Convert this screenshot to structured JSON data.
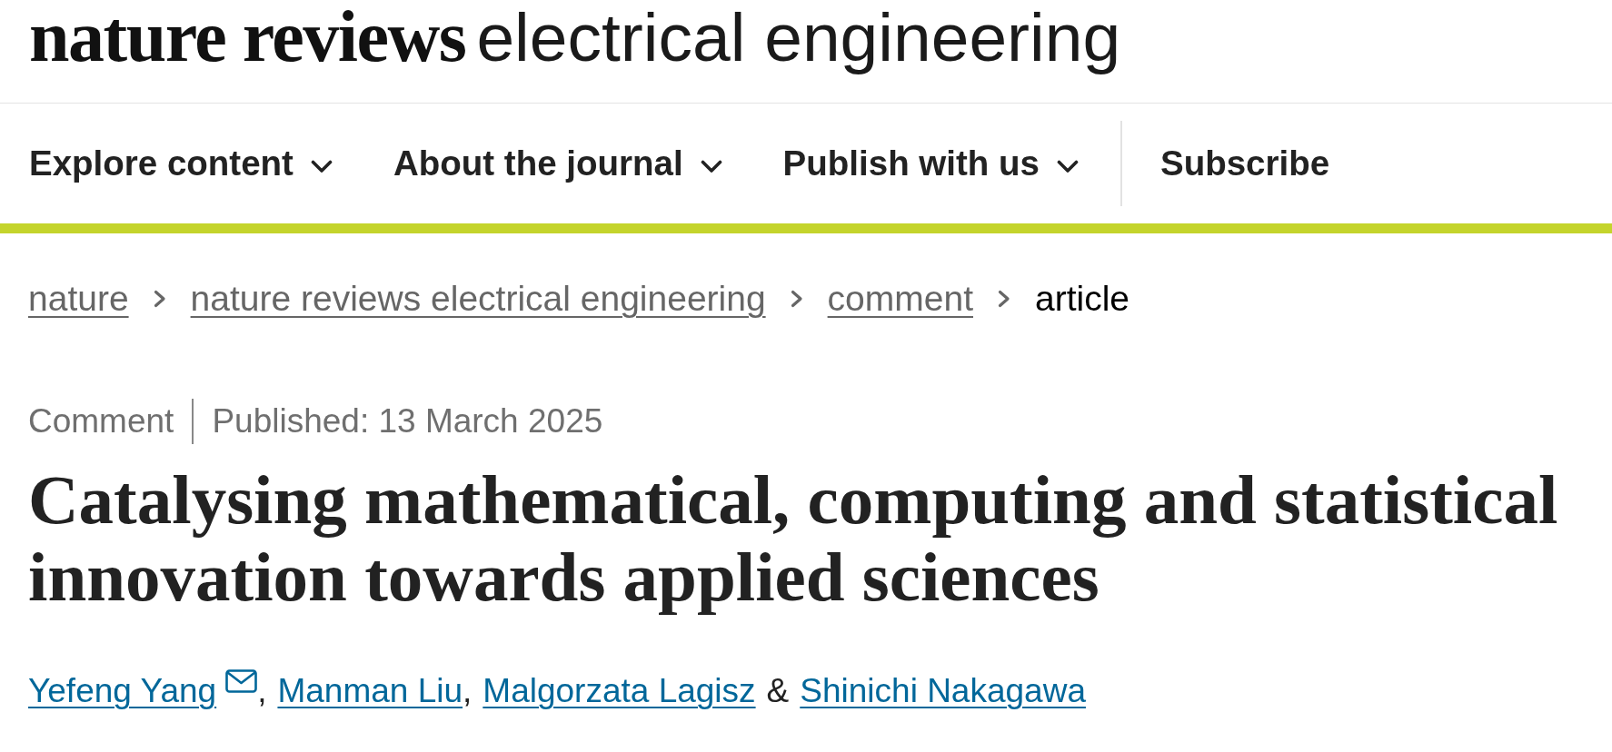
{
  "masthead": {
    "brand": "nature reviews",
    "journal_name": "electrical engineering"
  },
  "nav": {
    "menus": [
      {
        "label": "Explore content",
        "expanded": false
      },
      {
        "label": "About the journal",
        "expanded": false
      },
      {
        "label": "Publish with us",
        "expanded": false
      }
    ],
    "subscribe": "Subscribe"
  },
  "breadcrumbs": [
    {
      "label": "nature",
      "current": false
    },
    {
      "label": "nature reviews electrical engineering",
      "current": false
    },
    {
      "label": "comment",
      "current": false
    },
    {
      "label": "article",
      "current": true
    }
  ],
  "article": {
    "type": "Comment",
    "published": "Published: 13 March 2025",
    "title": "Catalysing mathematical, computing and statistical innovation towards applied sciences",
    "authors": [
      {
        "name": "Yefeng Yang",
        "contact": true,
        "separator": ","
      },
      {
        "name": "Manman Liu",
        "contact": false,
        "separator": ","
      },
      {
        "name": "Malgorzata Lagisz",
        "contact": false,
        "separator": "&"
      },
      {
        "name": "Shinichi Nakagawa",
        "contact": false
      }
    ]
  }
}
